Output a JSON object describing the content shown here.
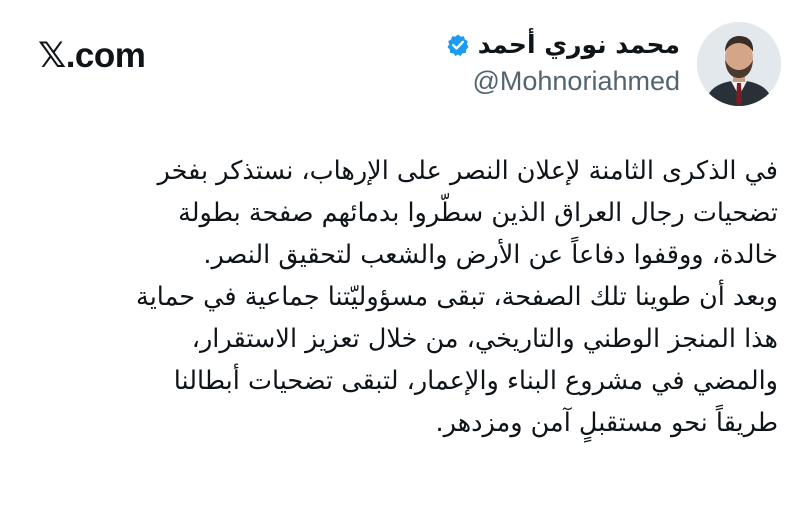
{
  "brand": {
    "label": "𝕏.com"
  },
  "author": {
    "display_name": "محمد نوري أحمد",
    "handle": "@Mohnoriahmed",
    "verified": true,
    "avatar_icon": "profile-photo",
    "verified_color": "#1d9bf0"
  },
  "tweet": {
    "lines": [
      "في الذكرى الثامنة لإعلان النصر على الإرهاب، نستذكر بفخر",
      "تضحيات رجال العراق الذين سطّروا بدمائهم صفحة بطولة",
      "خالدة، ووقفوا دفاعاً عن الأرض والشعب لتحقيق النصر.",
      "وبعد أن طوينا تلك الصفحة، تبقى مسؤوليّتنا جماعية في حماية",
      "هذا المنجز الوطني والتاريخي، من خلال تعزيز الاستقرار،",
      "والمضي في مشروع البناء والإعمار، لتبقى تضحيات أبطالنا",
      "طريقاً نحو مستقبلٍ آمن ومزدهر."
    ]
  }
}
